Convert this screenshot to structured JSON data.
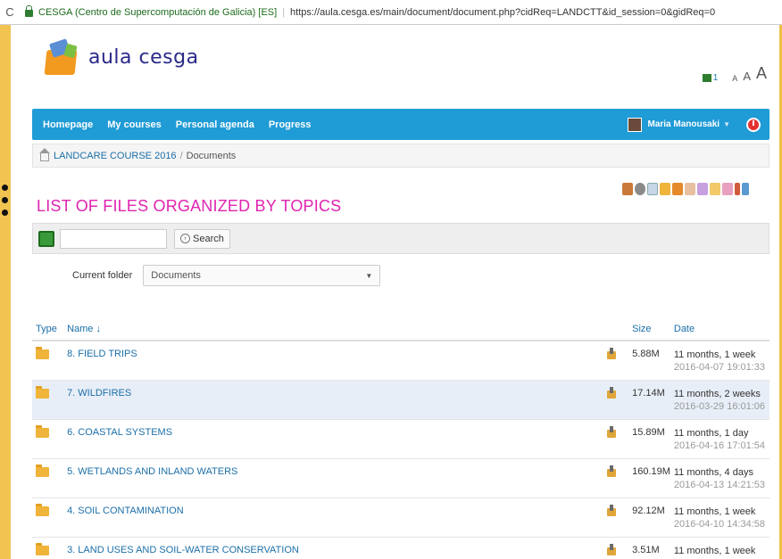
{
  "browser": {
    "site_name": "CESGA (Centro de Supercomputación de Galicia) [ES]",
    "url": "https://aula.cesga.es/main/document/document.php?cidReq=LANDCTT&id_session=0&gidReq=0"
  },
  "header": {
    "logo_text": "aula cesga",
    "badge_count": "1",
    "font_small": "A",
    "font_mid": "A",
    "font_big": "A"
  },
  "nav": {
    "items": [
      "Homepage",
      "My courses",
      "Personal agenda",
      "Progress"
    ],
    "user_name": "Maria Manousaki"
  },
  "breadcrumb": {
    "course": "LANDCARE COURSE 2016",
    "separator": "/",
    "current": "Documents"
  },
  "page_title": "LIST OF FILES ORGANIZED BY TOPICS",
  "search": {
    "value": "",
    "button_label": "Search"
  },
  "folder": {
    "label": "Current folder",
    "selected": "Documents"
  },
  "table": {
    "headers": {
      "type": "Type",
      "name": "Name ↓",
      "size": "Size",
      "date": "Date"
    },
    "rows": [
      {
        "name": "8. FIELD TRIPS",
        "size": "5.88M",
        "date_rel": "11 months, 1 week",
        "date_abs": "2016-04-07 19:01:33"
      },
      {
        "name": "7. WILDFIRES",
        "size": "17.14M",
        "date_rel": "11 months, 2 weeks",
        "date_abs": "2016-03-29 16:01:06"
      },
      {
        "name": "6. COASTAL SYSTEMS",
        "size": "15.89M",
        "date_rel": "11 months, 1 day",
        "date_abs": "2016-04-16 17:01:54"
      },
      {
        "name": "5. WETLANDS AND INLAND WATERS",
        "size": "160.19M",
        "date_rel": "11 months, 4 days",
        "date_abs": "2016-04-13 14:21:53"
      },
      {
        "name": "4. SOIL CONTAMINATION",
        "size": "92.12M",
        "date_rel": "11 months, 1 week",
        "date_abs": "2016-04-10 14:34:58"
      },
      {
        "name": "3. LAND USES AND SOIL-WATER CONSERVATION",
        "size": "3.51M",
        "date_rel": "11 months, 1 week",
        "date_abs": ""
      }
    ]
  },
  "colors": {
    "accent": "#1f9bd6",
    "title": "#e024b0",
    "link": "#1b6fa8"
  }
}
